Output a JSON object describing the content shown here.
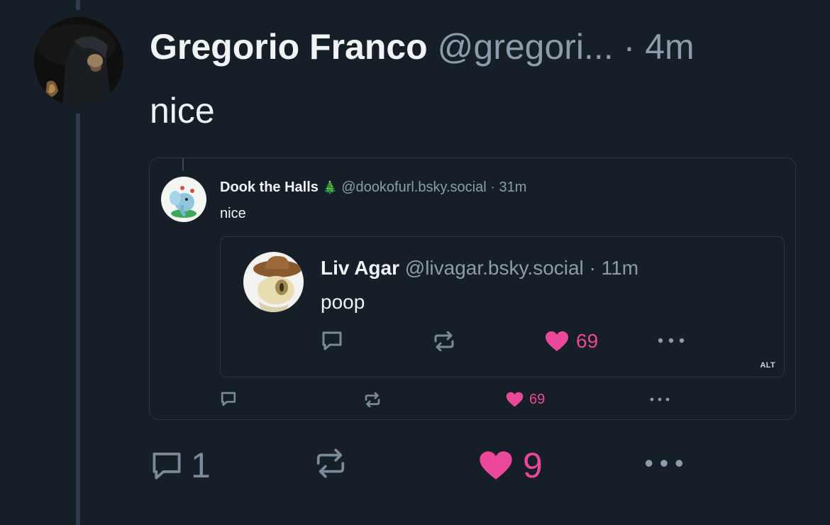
{
  "post": {
    "author_name": "Gregorio Franco",
    "handle": "@gregori...",
    "separator": "·",
    "time": "4m",
    "text": "nice",
    "reply_count": "1",
    "like_count": "9",
    "avatar_icon": "hooded-figure-avatar"
  },
  "quote": {
    "author_name": "Dook the Halls",
    "emoji": "🎄",
    "handle": "@dookofurl.bsky.social",
    "separator": "·",
    "time": "31m",
    "text": "nice",
    "like_count": "69",
    "avatar_icon": "elephant-plush-avatar"
  },
  "nested_quote": {
    "author_name": "Liv Agar",
    "handle": "@livagar.bsky.social",
    "separator": "·",
    "time": "11m",
    "text": "poop",
    "like_count": "69",
    "alt_badge": "ALT",
    "avatar_icon": "cowboy-hat-character-avatar"
  },
  "colors": {
    "background": "#161e27",
    "like_pink": "#ec4899",
    "muted_text": "#8d9cac",
    "border": "#2b3644",
    "thread_line": "#2f3c4c"
  }
}
